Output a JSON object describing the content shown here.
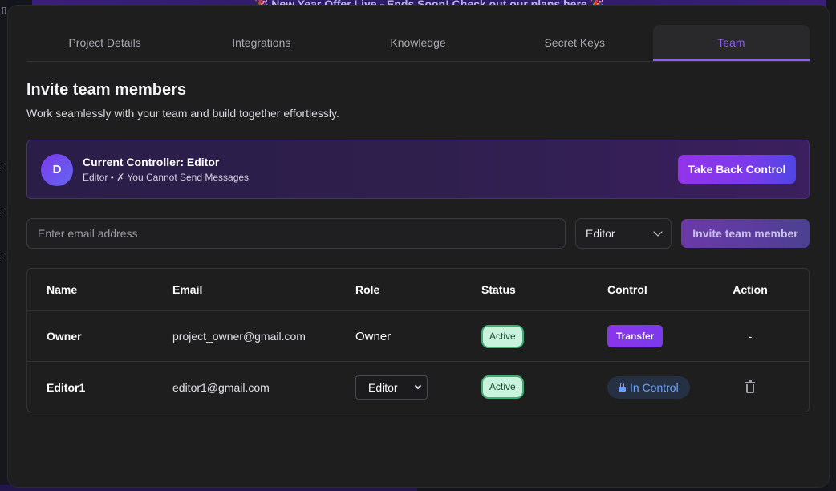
{
  "background": {
    "banner_text": "🎉 New Year Offer Live - Ends Soon! Check out our plans here 🎉"
  },
  "tabs": [
    {
      "label": "Project Details",
      "active": false
    },
    {
      "label": "Integrations",
      "active": false
    },
    {
      "label": "Knowledge",
      "active": false
    },
    {
      "label": "Secret Keys",
      "active": false
    },
    {
      "label": "Team",
      "active": true
    }
  ],
  "heading": "Invite team members",
  "subheading": "Work seamlessly with your team and build together effortlessly.",
  "controller": {
    "avatar_letter": "D",
    "title": "Current Controller: Editor",
    "subtitle": "Editor • ✗ You Cannot Send Messages",
    "take_back_label": "Take Back Control"
  },
  "invite": {
    "email_placeholder": "Enter email address",
    "email_value": "",
    "role_selected": "Editor",
    "invite_label": "Invite team member"
  },
  "table": {
    "columns": [
      "Name",
      "Email",
      "Role",
      "Status",
      "Control",
      "Action"
    ],
    "rows": [
      {
        "name": "Owner",
        "email": "project_owner@gmail.com",
        "role": "Owner",
        "status": "Active",
        "control": "Transfer",
        "action": "-"
      },
      {
        "name": "Editor1",
        "email": "editor1@gmail.com",
        "role": "Editor",
        "status": "Active",
        "control": "In Control",
        "action": "delete"
      }
    ]
  },
  "colors": {
    "accent": "#8b5cf6",
    "active_badge_bg": "#c9f3dd",
    "in_control_text": "#6aa0ff"
  }
}
